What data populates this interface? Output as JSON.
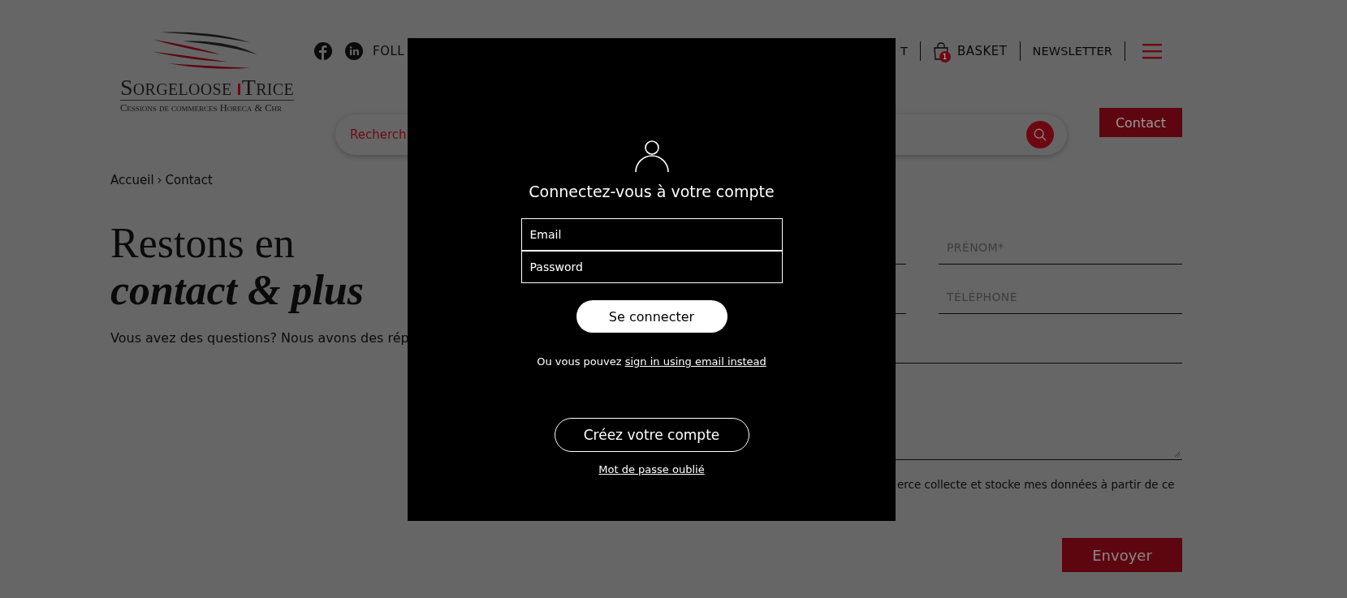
{
  "logo": {
    "name_left": "Sorgeloose",
    "name_right": "Trice",
    "tagline": "Cessions de commerces Horeca & Chr"
  },
  "header": {
    "follow_label": "FOLL",
    "cut_link": "T",
    "basket": {
      "label": "BASKET",
      "count": "1"
    },
    "newsletter": "NEWSLETTER"
  },
  "search": {
    "placeholder": "Recherch"
  },
  "contact_button": "Contact",
  "breadcrumb": {
    "items": [
      "Accueil",
      "Contact"
    ],
    "separator": "›"
  },
  "heading": {
    "text": "Restons en",
    "emphasis": "contact & plus"
  },
  "intro": "Vous avez des questions? Nous avons des rép",
  "form": {
    "fields": [
      {
        "placeholder": "PRÉNOM*"
      },
      {
        "placeholder": "TÉLÉPHONE"
      }
    ],
    "consent": "erce collecte et stocke mes données à partir de ce",
    "submit": "Envoyer"
  },
  "login_modal": {
    "title": "Connectez-vous à votre compte",
    "email_placeholder": "Email",
    "password_placeholder": "Password",
    "login_button": "Se connecter",
    "alt_text": "Ou vous pouvez",
    "alt_link": "sign in using email instead",
    "create_button": "Créez votre compte",
    "forgot_link": "Mot de passe oublié"
  }
}
